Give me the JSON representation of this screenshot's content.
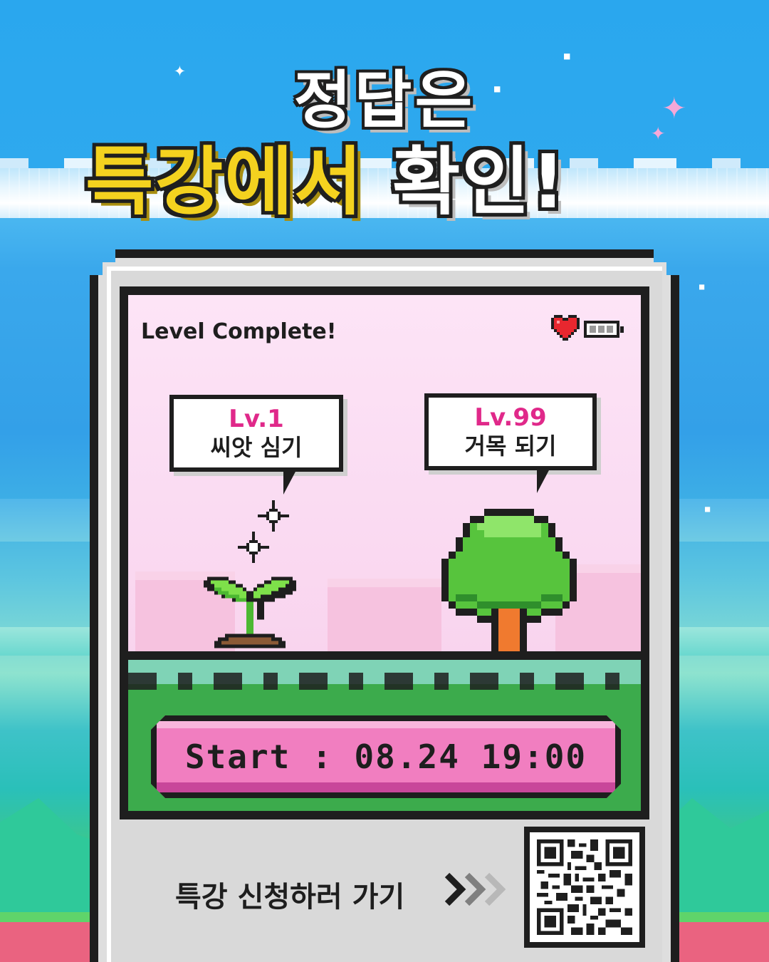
{
  "headline": {
    "line1": "정답은",
    "line2_yellow": "특강에서",
    "line2_white": "확인!"
  },
  "screen": {
    "title": "Level Complete!",
    "status_icons": [
      "heart-icon",
      "battery-icon"
    ],
    "bubbles": [
      {
        "level": "Lv.1",
        "label": "씨앗 심기"
      },
      {
        "level": "Lv.99",
        "label": "거목 되기"
      }
    ],
    "start_button": "Start : 08.24 19:00"
  },
  "footer": {
    "cta_label": "특강 신청하러 가기",
    "arrow_icon": "triple-chevron-right-icon",
    "qr_icon": "qr-code-icon"
  },
  "colors": {
    "sky": "#2aa7ee",
    "headline_yellow": "#f4d21f",
    "level_pink": "#e0298a",
    "button_pink": "#f17ec0",
    "grass": "#3cab4c"
  }
}
